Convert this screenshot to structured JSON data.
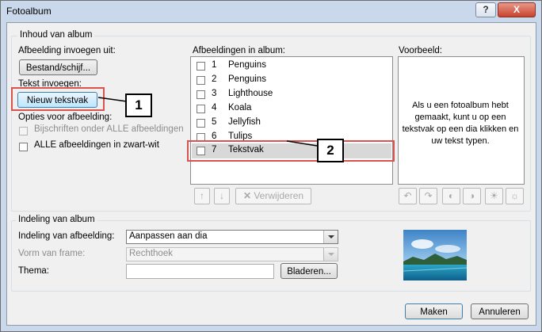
{
  "window": {
    "title": "Fotoalbum",
    "help_label": "?",
    "close_label": "X"
  },
  "content_group": {
    "title": "Inhoud van album",
    "insert_images_label": "Afbeelding invoegen uit:",
    "file_button": "Bestand/schijf...",
    "insert_text_label": "Tekst invoegen:",
    "new_textbox_button": "Nieuw tekstvak",
    "picture_options_label": "Opties voor afbeelding:",
    "captions_checkbox": "Bijschriften onder ALLE afbeeldingen",
    "bw_checkbox": "ALLE afbeeldingen in zwart-wit"
  },
  "album_list": {
    "label": "Afbeeldingen in album:",
    "items": [
      {
        "num": "1",
        "name": "Penguins"
      },
      {
        "num": "2",
        "name": "Penguins"
      },
      {
        "num": "3",
        "name": "Lighthouse"
      },
      {
        "num": "4",
        "name": "Koala"
      },
      {
        "num": "5",
        "name": "Jellyfish"
      },
      {
        "num": "6",
        "name": "Tulips"
      },
      {
        "num": "7",
        "name": "Tekstvak"
      }
    ],
    "selected_index": 6,
    "remove_button": "Verwijderen"
  },
  "preview": {
    "label": "Voorbeeld:",
    "text": "Als u een fotoalbum hebt gemaakt, kunt u op een tekstvak op een dia klikken en uw tekst typen."
  },
  "layout_group": {
    "title": "Indeling van album",
    "picture_layout_label": "Indeling van afbeelding:",
    "picture_layout_value": "Aanpassen aan dia",
    "frame_shape_label": "Vorm van frame:",
    "frame_shape_value": "Rechthoek",
    "theme_label": "Thema:",
    "theme_value": "",
    "browse_button": "Bladeren..."
  },
  "callouts": {
    "one": "1",
    "two": "2"
  },
  "footer": {
    "create_button": "Maken",
    "cancel_button": "Annuleren"
  },
  "icons": {
    "move_up": "arrow-up-icon",
    "move_down": "arrow-down-icon",
    "remove": "x-icon"
  }
}
